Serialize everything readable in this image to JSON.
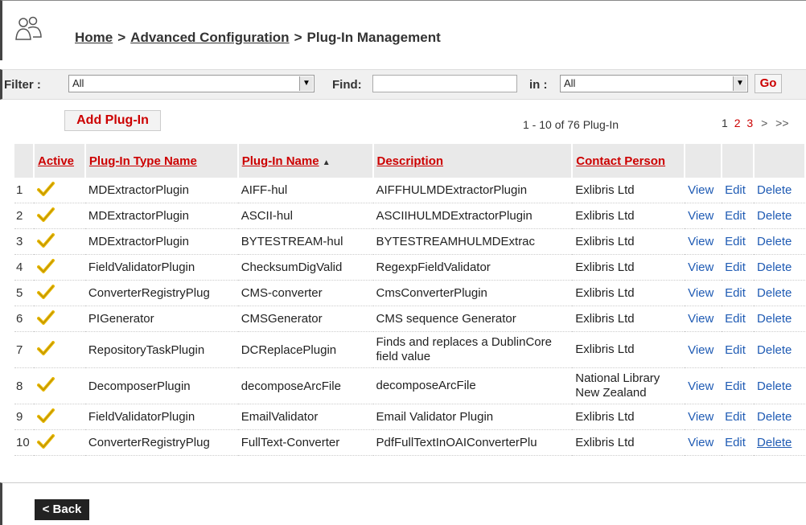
{
  "breadcrumb": {
    "home": "Home",
    "advanced": "Advanced Configuration",
    "current": "Plug-In Management",
    "separator": ">"
  },
  "filter": {
    "label": "Filter :",
    "value": "All",
    "find_label": "Find:",
    "find_value": "",
    "in_label": "in :",
    "in_value": "All",
    "go_label": "Go"
  },
  "toolbar": {
    "add_label": "Add Plug-In",
    "count_text": "1 - 10 of 76 Plug-In",
    "pages": [
      "1",
      "2",
      "3"
    ],
    "next": ">",
    "last": ">>"
  },
  "table": {
    "headers": {
      "active": "Active",
      "type": "Plug-In Type Name",
      "name": "Plug-In Name",
      "sort_indicator": "▲",
      "description": "Description",
      "contact": "Contact Person"
    },
    "action_labels": {
      "view": "View",
      "edit": "Edit",
      "delete": "Delete"
    },
    "rows": [
      {
        "num": "1",
        "type": "MDExtractorPlugin",
        "name": "AIFF-hul",
        "description": "AIFFHULMDExtractorPlugin",
        "contact": "Exlibris Ltd"
      },
      {
        "num": "2",
        "type": "MDExtractorPlugin",
        "name": "ASCII-hul",
        "description": "ASCIIHULMDExtractorPlugin",
        "contact": "Exlibris Ltd"
      },
      {
        "num": "3",
        "type": "MDExtractorPlugin",
        "name": "BYTESTREAM-hul",
        "description": "BYTESTREAMHULMDExtrac",
        "contact": "Exlibris Ltd"
      },
      {
        "num": "4",
        "type": "FieldValidatorPlugin",
        "name": "ChecksumDigValid",
        "description": "RegexpFieldValidator",
        "contact": "Exlibris Ltd"
      },
      {
        "num": "5",
        "type": "ConverterRegistryPlug",
        "name": "CMS-converter",
        "description": "CmsConverterPlugin",
        "contact": "Exlibris Ltd"
      },
      {
        "num": "6",
        "type": "PIGenerator",
        "name": "CMSGenerator",
        "description": "CMS sequence Generator",
        "contact": "Exlibris Ltd"
      },
      {
        "num": "7",
        "type": "RepositoryTaskPlugin",
        "name": "DCReplacePlugin",
        "description": "Finds and replaces a DublinCore field value",
        "contact": "Exlibris Ltd"
      },
      {
        "num": "8",
        "type": "DecomposerPlugin",
        "name": "decomposeArcFile",
        "description": "decomposeArcFile",
        "contact": "National Library New Zealand"
      },
      {
        "num": "9",
        "type": "FieldValidatorPlugin",
        "name": "EmailValidator",
        "description": "Email Validator Plugin",
        "contact": "Exlibris Ltd"
      },
      {
        "num": "10",
        "type": "ConverterRegistryPlug",
        "name": "FullText-Converter",
        "description": "PdfFullTextInOAIConverterPlu",
        "contact": "Exlibris Ltd"
      }
    ]
  },
  "footer": {
    "back_label": "< Back"
  },
  "colors": {
    "accent_red": "#cc0000",
    "link_blue": "#1f5bb4",
    "check_yellow": "#e8b800"
  }
}
